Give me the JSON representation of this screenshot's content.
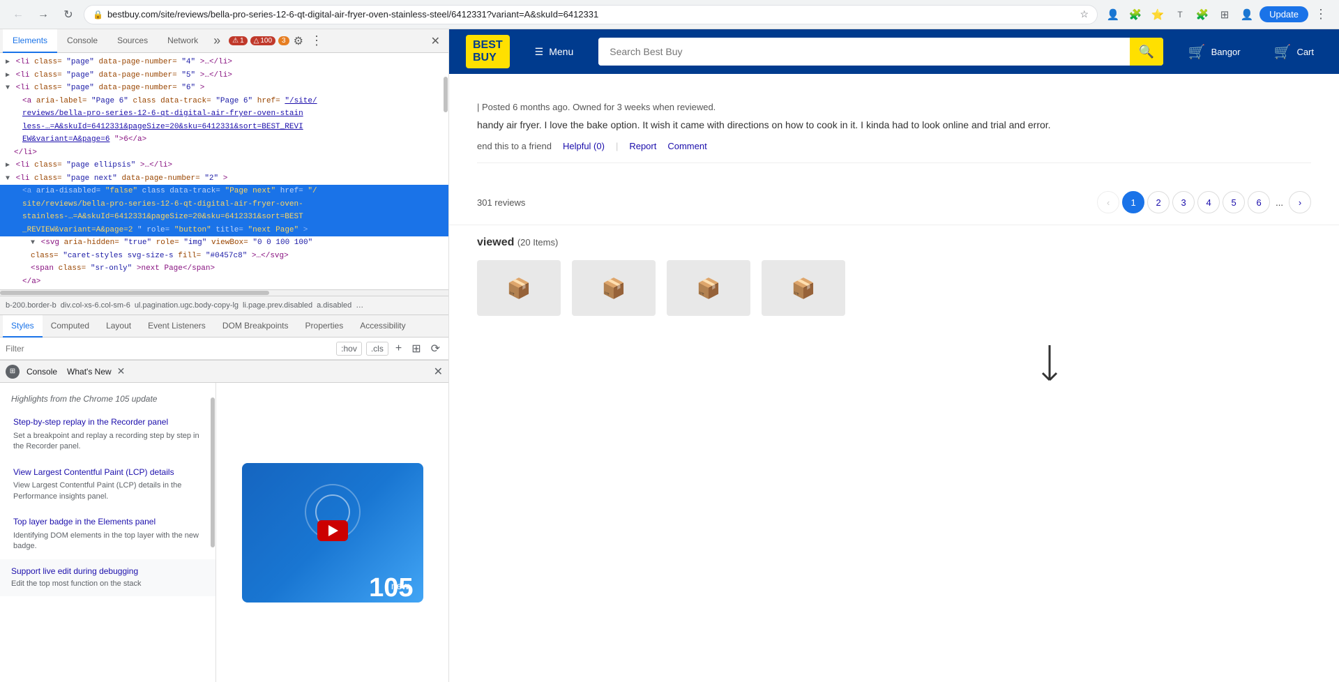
{
  "browser": {
    "url": "bestbuy.com/site/reviews/bella-pro-series-12-6-qt-digital-air-fryer-oven-stainless-steel/6412331?variant=A&skuId=6412331",
    "back_btn": "←",
    "forward_btn": "→",
    "reload_btn": "↻",
    "update_btn": "Update",
    "extensions": [
      "profile-icon",
      "extensions-icon",
      "bookmarks-icon",
      "translate-icon",
      "puzzle-icon",
      "grid-icon",
      "person-icon"
    ]
  },
  "devtools": {
    "tabs": [
      "Elements",
      "Console",
      "Sources",
      "Network"
    ],
    "tabs_more": "»",
    "badge_red_icon": "⚠",
    "badge_red_count": "1",
    "badge_yellow_count": "100",
    "badge_orange_count": "3",
    "settings_icon": "⚙",
    "menu_icon": "⋮",
    "close_icon": "✕"
  },
  "dom_tree": {
    "lines": [
      {
        "indent": 0,
        "content": "▶ <li class=\"page\" data-page-number=\"4\">…</li>"
      },
      {
        "indent": 0,
        "content": "▶ <li class=\"page\" data-page-number=\"5\">…</li>"
      },
      {
        "indent": 0,
        "content": "▼ <li class=\"page\" data-page-number=\"6\">"
      },
      {
        "indent": 2,
        "content": "<a aria-label=\"Page 6\" class data-track=\"Page 6\" href=\"/site/"
      },
      {
        "indent": 2,
        "content": "reviews/bella-pro-series-12-6-qt-digital-air-fryer-oven-stain",
        "is_link": true
      },
      {
        "indent": 2,
        "content": "less-…=A&skuId=6412331&pageSize=20&sku=6412331&sort=BEST_REVI",
        "is_link": true
      },
      {
        "indent": 2,
        "content": "EW&variant=A&page=6\">6</a>"
      },
      {
        "indent": 1,
        "content": "</li>"
      },
      {
        "indent": 0,
        "content": "▶ <li class=\"page ellipsis\">…</li>"
      },
      {
        "indent": 0,
        "content": "▼ <li class=\"page next\" data-page-number=\"2\">"
      },
      {
        "indent": 2,
        "content": "<a aria-disabled=\"false\" class data-track=\"Page next\" href=\"/"
      },
      {
        "indent": 2,
        "content": "site/reviews/bella-pro-series-12-6-qt-digital-air-fryer-oven-",
        "is_link": true,
        "selected": true
      },
      {
        "indent": 2,
        "content": "stainless-…=A&skuId=6412331&pageSize=20&sku=6412331&sort=BEST",
        "is_link": true,
        "selected": true
      },
      {
        "indent": 2,
        "content": "_REVIEW&variant=A&page=2\" role=\"button\" title=\"next Page\">",
        "selected": true
      },
      {
        "indent": 3,
        "content": "▼ <svg aria-hidden=\"true\" role=\"img\" viewBox=\"0 0 100 100\""
      },
      {
        "indent": 3,
        "content": "class=\"caret-styles svg-size-s fill=\"#0457c8\">…</svg>"
      },
      {
        "indent": 4,
        "content": "<span class=\"sr-only\">next Page</span>"
      },
      {
        "indent": 2,
        "content": "</a>"
      },
      {
        "indent": 1,
        "content": "</li>"
      }
    ]
  },
  "breadcrumb": {
    "items": [
      "b-200.border-b",
      "div.col-xs-6.col-sm-6",
      "ul.pagination.ugc.body-copy-lg",
      "li.page.prev.disabled",
      "a.disabled",
      "…"
    ]
  },
  "style_panel": {
    "tabs": [
      "Styles",
      "Computed",
      "Layout",
      "Event Listeners",
      "DOM Breakpoints",
      "Properties",
      "Accessibility"
    ],
    "filter_placeholder": "Filter",
    "filter_hov": ":hov",
    "filter_cls": ".cls",
    "filter_add": "+",
    "filter_layout": "⊞",
    "filter_scroll": "⟳"
  },
  "console_panel": {
    "console_tab": "Console",
    "whatsnew_tab": "What's New",
    "close_icon": "✕"
  },
  "whatsnew": {
    "highlight_text": "Highlights from the Chrome 105 update",
    "items": [
      {
        "title": "Step-by-step replay in the Recorder panel",
        "desc": "Set a breakpoint and replay a recording step by step in the Recorder panel."
      },
      {
        "title": "View Largest Contentful Paint (LCP) details",
        "desc": "View Largest Contentful Paint (LCP) details in the Performance insights panel."
      },
      {
        "title": "Top layer badge in the Elements panel",
        "desc": "Identifying DOM elements in the top layer with the new badge."
      },
      {
        "title": "Support live edit during debugging",
        "desc": "Edit the top most function on the stack"
      }
    ],
    "video_new": "new",
    "video_number": "105"
  },
  "bestbuy": {
    "logo_line1": "BEST",
    "logo_line2": "BUY",
    "menu_label": "Menu",
    "search_placeholder": "Search Best Buy",
    "account_label": "Bangor",
    "cart_label": "Cart",
    "review_meta": "| Posted 6 months ago. Owned for 3 weeks when reviewed.",
    "review_text": "handy air fryer. I love the bake option. It wish it came with directions on how to cook in it. I kinda had to look online and trial and error.",
    "helpful_label": "Helpful (0)",
    "report_label": "Report",
    "comment_label": "Comment",
    "send_label": "end this to a friend",
    "total_reviews": "301 reviews",
    "pagination": {
      "prev_icon": "‹",
      "pages": [
        "1",
        "2",
        "3",
        "4",
        "5",
        "6"
      ],
      "dots": "...",
      "next_icon": "›"
    },
    "also_viewed_title": "viewed",
    "also_viewed_count": "(20 Items)"
  }
}
